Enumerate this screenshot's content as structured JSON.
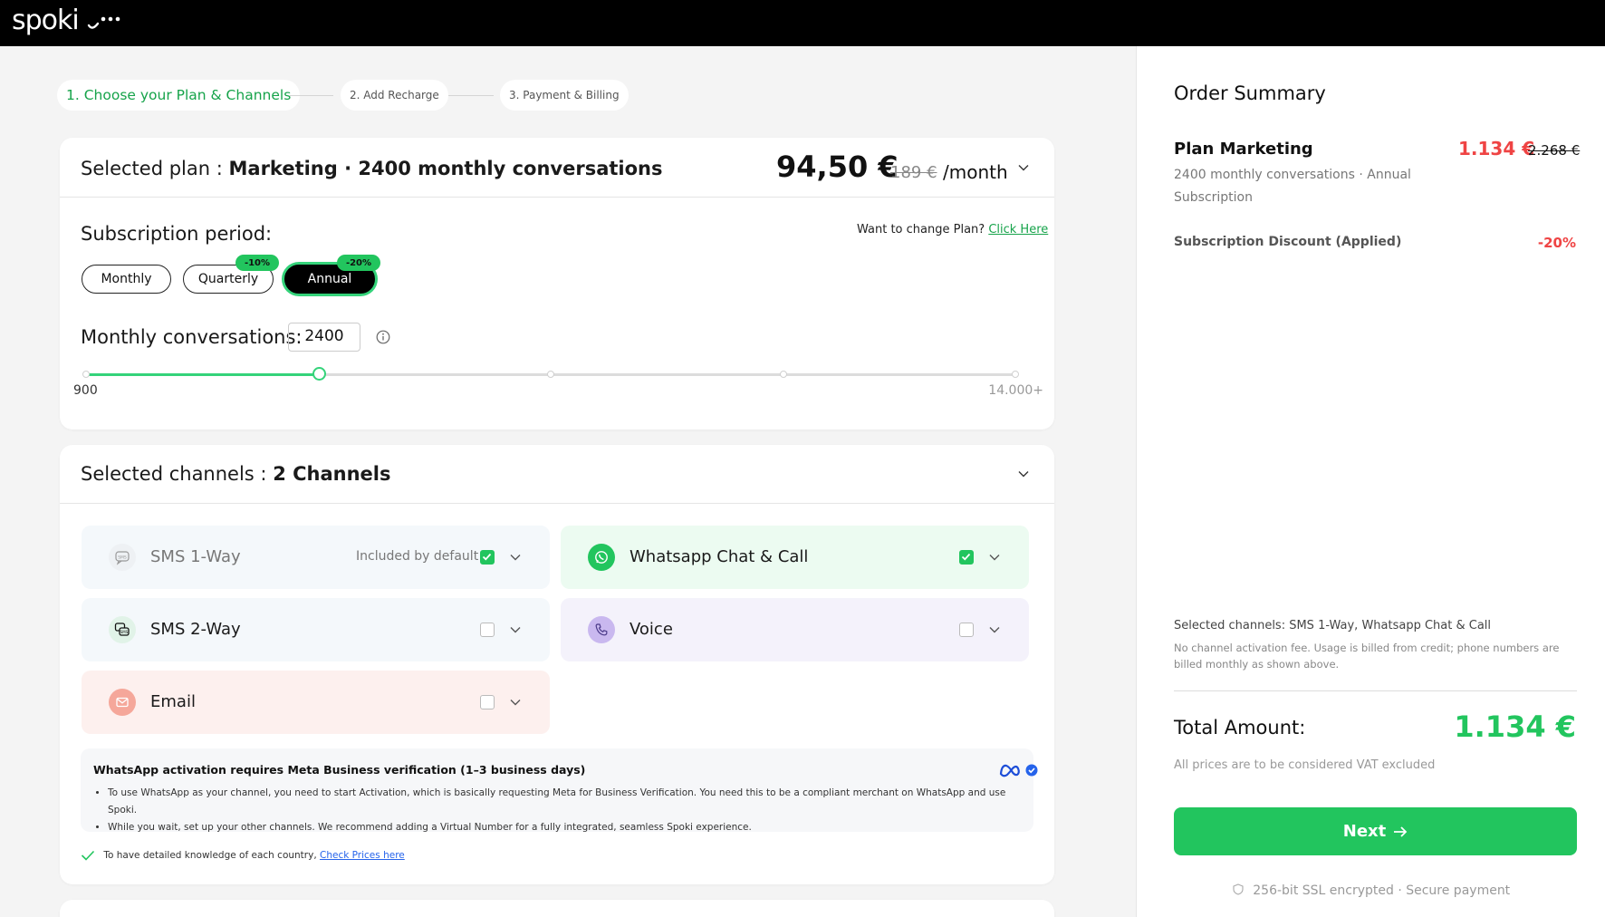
{
  "brand": {
    "name": "spoki"
  },
  "colors": {
    "accent": "#22c55e",
    "danger": "#ef4444",
    "dark": "#000000"
  },
  "stepper": {
    "steps": [
      {
        "label": "1. Choose your Plan & Channels",
        "active": true
      },
      {
        "label": "2. Add Recharge",
        "active": false
      },
      {
        "label": "3. Payment & Billing",
        "active": false
      }
    ]
  },
  "plan": {
    "selected_label": "Selected plan :",
    "selected_value": "Marketing · 2400 monthly conversations",
    "price": "94,50 €",
    "price_old": "189 €",
    "price_unit": "/month",
    "subscription_label": "Subscription period:",
    "change_plan_text": "Want to change Plan?",
    "change_plan_link": "Click Here",
    "periods": [
      {
        "label": "Monthly",
        "badge": ""
      },
      {
        "label": "Quarterly",
        "badge": "-10%"
      },
      {
        "label": "Annual",
        "badge": "-20%",
        "active": true
      }
    ],
    "conversations_label": "Monthly conversations:",
    "conversations_value": "2400",
    "slider": {
      "min_label": "900",
      "max_label": "14.000+",
      "value_fraction": 0.25
    }
  },
  "channels": {
    "selected_label": "Selected channels :",
    "selected_value": "2 Channels",
    "items": [
      {
        "name": "SMS 1-Way",
        "note": "Included by default",
        "checked": true,
        "icon": "sms-icon"
      },
      {
        "name": "Whatsapp Chat & Call",
        "note": "",
        "checked": true,
        "icon": "whatsapp-icon"
      },
      {
        "name": "SMS 2-Way",
        "note": "",
        "checked": false,
        "icon": "sms-two-way-icon"
      },
      {
        "name": "Voice",
        "note": "",
        "checked": false,
        "icon": "phone-icon"
      },
      {
        "name": "Email",
        "note": "",
        "checked": false,
        "icon": "mail-icon"
      }
    ],
    "wa_info": {
      "title": "WhatsApp activation requires Meta Business verification (1–3 business days)",
      "bullets": [
        "To use WhatsApp as your channel, you need to start Activation, which is basically requesting Meta for Business Verification. You need this to be a compliant merchant on WhatsApp and use Spoki.",
        "While you wait, set up your other channels. We recommend adding a Virtual Number for a fully integrated, seamless Spoki experience."
      ]
    },
    "country_note": "To have detailed knowledge of each country,",
    "country_link": "Check Prices here"
  },
  "summary": {
    "title": "Order Summary",
    "plan_name": "Plan Marketing",
    "plan_price": "1.134 €",
    "plan_price_old": "2.268 €",
    "plan_desc": "2400 monthly conversations · Annual Subscription",
    "discount_label": "Subscription Discount (Applied)",
    "discount_value": "-20%",
    "channels_text": "Selected channels: SMS 1-Way, Whatsapp Chat & Call",
    "channels_note": "No channel activation fee. Usage is billed from credit; phone numbers are billed monthly as shown above.",
    "total_label": "Total Amount:",
    "total_value": "1.134 €",
    "vat_note": "All prices are to be considered VAT excluded",
    "next_label": "Next",
    "ssl_text": "256-bit SSL encrypted · Secure payment"
  }
}
